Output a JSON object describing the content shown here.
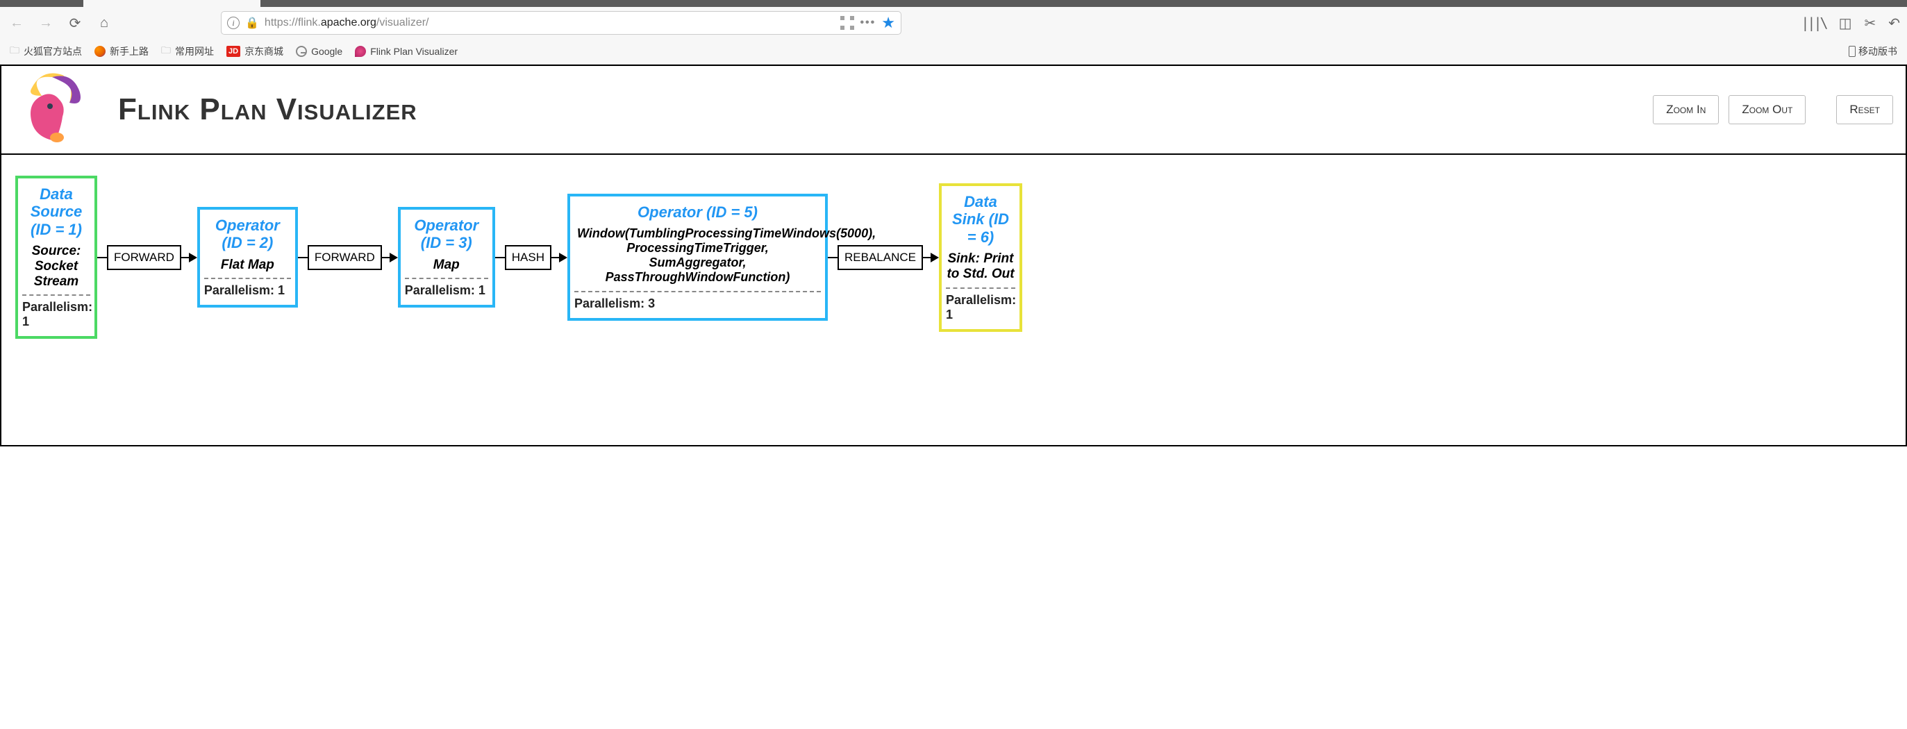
{
  "browser": {
    "url_prefix": "https://flink.",
    "url_domain": "apache.org",
    "url_path": "/visualizer/",
    "bookmarks": {
      "b1": "火狐官方站点",
      "b2": "新手上路",
      "b3": "常用网址",
      "b4": "京东商城",
      "b5": "Google",
      "b6": "Flink Plan Visualizer",
      "mobile": "移动版书"
    }
  },
  "page": {
    "title": "Flink Plan Visualizer",
    "buttons": {
      "zoom_in": "Zoom In",
      "zoom_out": "Zoom Out",
      "reset": "Reset"
    }
  },
  "graph": {
    "nodes": {
      "n1": {
        "title": "Data Source (ID = 1)",
        "desc": "Source: Socket Stream",
        "para": "Parallelism: 1"
      },
      "n2": {
        "title": "Operator (ID = 2)",
        "desc": "Flat Map",
        "para": "Parallelism: 1"
      },
      "n3": {
        "title": "Operator (ID = 3)",
        "desc": "Map",
        "para": "Parallelism: 1"
      },
      "n5": {
        "title": "Operator (ID = 5)",
        "desc": "Window(TumblingProcessingTimeWindows(5000), ProcessingTimeTrigger, SumAggregator, PassThroughWindowFunction)",
        "para": "Parallelism: 3"
      },
      "n6": {
        "title": "Data Sink (ID = 6)",
        "desc": "Sink: Print to Std. Out",
        "para": "Parallelism: 1"
      }
    },
    "edges": {
      "e1": "FORWARD",
      "e2": "FORWARD",
      "e3": "HASH",
      "e4": "REBALANCE"
    }
  }
}
